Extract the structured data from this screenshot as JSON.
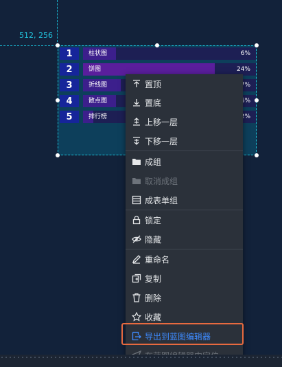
{
  "canvas": {
    "coord_label": "512, 256"
  },
  "ranking": {
    "rows": [
      {
        "rank": "1",
        "label": "柱状图",
        "value": "6%",
        "share": 0.19
      },
      {
        "rank": "2",
        "label": "饼图",
        "value": "24%",
        "share": 0.76
      },
      {
        "rank": "3",
        "label": "折线图",
        "value": "7%",
        "share": 0.22
      },
      {
        "rank": "4",
        "label": "散点图",
        "value": "6%",
        "share": 0.19
      },
      {
        "rank": "5",
        "label": "排行榜",
        "value": "2%",
        "share": 0.06
      }
    ]
  },
  "context_menu": {
    "items": {
      "top": "置顶",
      "bottom": "置底",
      "up": "上移一层",
      "down": "下移一层",
      "group": "成组",
      "ungroup": "取消成组",
      "table_group": "成表单组",
      "lock": "锁定",
      "hide": "隐藏",
      "rename": "重命名",
      "copy": "复制",
      "delete": "删除",
      "collect": "收藏",
      "export": "导出到蓝图编辑器",
      "locate": "在蓝图编辑器中定位"
    }
  },
  "colors": {
    "background": "#12223a",
    "menu_bg": "#2b313a",
    "highlight_text": "#3e8bff",
    "highlight_border": "#e86a3f",
    "guide": "#19b3cc"
  }
}
